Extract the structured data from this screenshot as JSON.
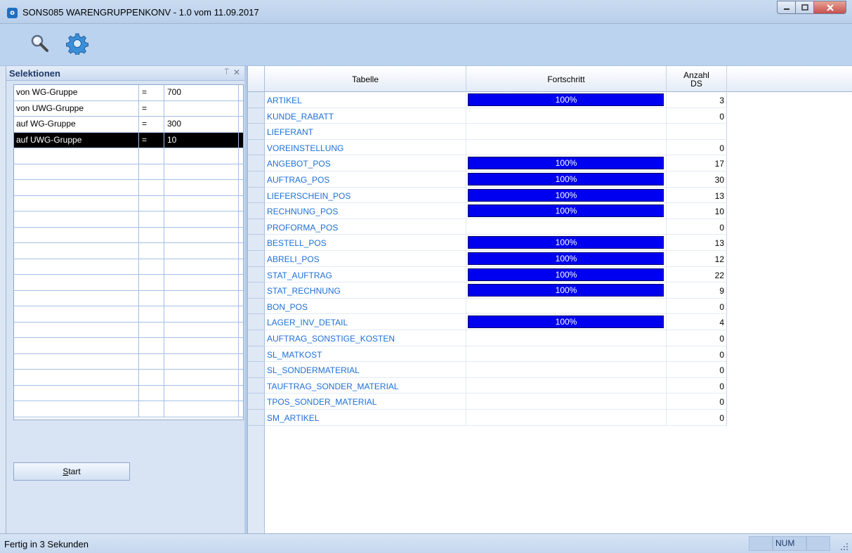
{
  "window": {
    "title": "SONS085 WARENGRUPPENKONV - 1.0 vom 11.09.2017",
    "app_icon_letter": "o",
    "controls": [
      "minimize",
      "maximize",
      "close"
    ]
  },
  "toolbar": {
    "buttons": [
      {
        "icon": "search-icon"
      },
      {
        "icon": "gear-icon"
      }
    ]
  },
  "left_panel": {
    "title": "Selektionen",
    "pin_glyph": "⍑",
    "close_glyph": "✕",
    "selections": [
      {
        "label": "von  WG-Gruppe",
        "op": "=",
        "value": "700",
        "selected": false
      },
      {
        "label": "von  UWG-Gruppe",
        "op": "=",
        "value": "",
        "selected": false
      },
      {
        "label": "auf  WG-Gruppe",
        "op": "=",
        "value": "300",
        "selected": false
      },
      {
        "label": "auf  UWG-Gruppe",
        "op": "=",
        "value": "10",
        "selected": true
      }
    ],
    "empty_rows": 17,
    "start_label": "Start"
  },
  "grid": {
    "headers": {
      "table": "Tabelle",
      "progress": "Fortschritt",
      "count_line1": "Anzahl",
      "count_line2": "DS"
    },
    "rows": [
      {
        "name": "ARTIKEL",
        "progress": 100,
        "progress_label": "100%",
        "count": "3"
      },
      {
        "name": "KUNDE_RABATT",
        "progress": null,
        "progress_label": "",
        "count": "0"
      },
      {
        "name": "LIEFERANT",
        "progress": null,
        "progress_label": "",
        "count": ""
      },
      {
        "name": "VOREINSTELLUNG",
        "progress": null,
        "progress_label": "",
        "count": "0"
      },
      {
        "name": "ANGEBOT_POS",
        "progress": 100,
        "progress_label": "100%",
        "count": "17"
      },
      {
        "name": "AUFTRAG_POS",
        "progress": 100,
        "progress_label": "100%",
        "count": "30"
      },
      {
        "name": "LIEFERSCHEIN_POS",
        "progress": 100,
        "progress_label": "100%",
        "count": "13"
      },
      {
        "name": "RECHNUNG_POS",
        "progress": 100,
        "progress_label": "100%",
        "count": "10"
      },
      {
        "name": "PROFORMA_POS",
        "progress": null,
        "progress_label": "",
        "count": "0"
      },
      {
        "name": "BESTELL_POS",
        "progress": 100,
        "progress_label": "100%",
        "count": "13"
      },
      {
        "name": "ABRELI_POS",
        "progress": 100,
        "progress_label": "100%",
        "count": "12"
      },
      {
        "name": "STAT_AUFTRAG",
        "progress": 100,
        "progress_label": "100%",
        "count": "22"
      },
      {
        "name": "STAT_RECHNUNG",
        "progress": 100,
        "progress_label": "100%",
        "count": "9"
      },
      {
        "name": "BON_POS",
        "progress": null,
        "progress_label": "",
        "count": "0"
      },
      {
        "name": "LAGER_INV_DETAIL",
        "progress": 100,
        "progress_label": "100%",
        "count": "4"
      },
      {
        "name": "AUFTRAG_SONSTIGE_KOSTEN",
        "progress": null,
        "progress_label": "",
        "count": "0"
      },
      {
        "name": "SL_MATKOST",
        "progress": null,
        "progress_label": "",
        "count": "0"
      },
      {
        "name": "SL_SONDERMATERIAL",
        "progress": null,
        "progress_label": "",
        "count": "0"
      },
      {
        "name": "TAUFTRAG_SONDER_MATERIAL",
        "progress": null,
        "progress_label": "",
        "count": "0"
      },
      {
        "name": "TPOS_SONDER_MATERIAL",
        "progress": null,
        "progress_label": "",
        "count": "0"
      },
      {
        "name": "SM_ARTIKEL",
        "progress": null,
        "progress_label": "",
        "count": "0"
      }
    ]
  },
  "statusbar": {
    "text": "Fertig in 3 Sekunden",
    "num": "NUM"
  },
  "colors": {
    "progress_bar": "#0000f0",
    "link_text": "#1d6fd6",
    "selected_row": "#000000"
  }
}
